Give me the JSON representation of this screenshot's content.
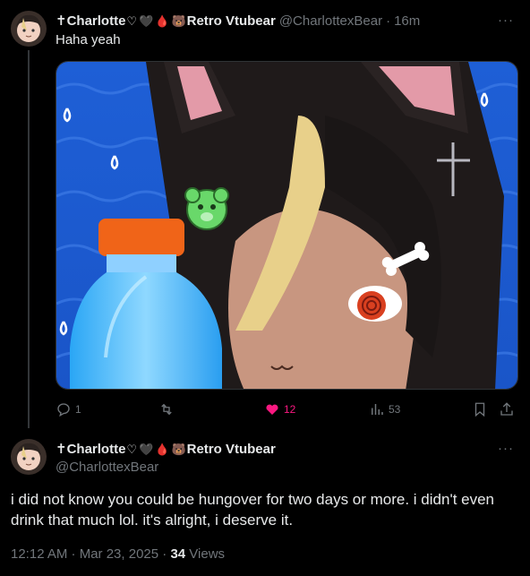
{
  "reply_tweet": {
    "display_name_prefix": "✝Charlotte",
    "display_name_suffix": "Retro Vtubear",
    "name_emojis": [
      "♡",
      "🖤",
      "🩸",
      "🐻"
    ],
    "handle": "@CharlottexBear",
    "separator": "·",
    "time": "16m",
    "more": "···",
    "text": "Haha yeah",
    "media_icon": "vtuber-image-with-gatorade-bottle",
    "actions": {
      "reply_count": "1",
      "retweet_count": "",
      "like_count": "12",
      "views_count": "53"
    }
  },
  "main_tweet": {
    "display_name_prefix": "✝Charlotte",
    "display_name_suffix": "Retro Vtubear",
    "name_emojis": [
      "♡",
      "🖤",
      "🩸",
      "🐻"
    ],
    "handle": "@CharlottexBear",
    "more": "···",
    "text": "i did not know you could be hungover for two days or more. i didn't even drink that much lol. it's alright, i deserve it.",
    "timestamp": "12:12 AM · Mar 23, 2025 · ",
    "views_number": "34",
    "views_label": " Views"
  },
  "colors": {
    "background": "#000000",
    "text": "#e7e9ea",
    "muted": "#71767b",
    "like": "#f91880",
    "border": "#2f3336"
  }
}
